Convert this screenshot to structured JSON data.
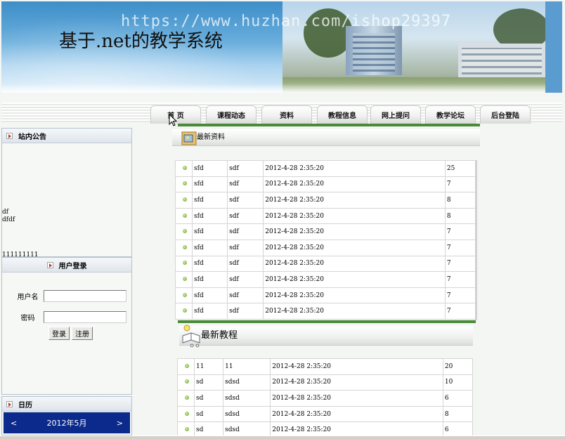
{
  "banner": {
    "watermark": "https://www.huzhan.com/ishop29397",
    "title": "基于.net的教学系统"
  },
  "nav": {
    "tabs": [
      "首 页",
      "课程动态",
      "资料",
      "教程信息",
      "网上提问",
      "教学论坛",
      "后台登陆"
    ]
  },
  "notice": {
    "heading": "站内公告",
    "lines": [
      "df",
      "dfdf"
    ],
    "bottom": "111111111"
  },
  "login": {
    "heading": "用户登录",
    "username_label": "用户名",
    "password_label": "密码",
    "username_value": "",
    "password_value": "",
    "login_button": "登录",
    "register_button": "注册"
  },
  "calendar": {
    "heading": "日历",
    "prev": "<",
    "month": "2012年5月",
    "next": ">"
  },
  "latest_materials": {
    "heading": "最新资料",
    "rows": [
      [
        "sfd",
        "sdf",
        "2012-4-28 2:35:20",
        "25"
      ],
      [
        "sfd",
        "sdf",
        "2012-4-28 2:35:20",
        "7"
      ],
      [
        "sfd",
        "sdf",
        "2012-4-28 2:35:20",
        "8"
      ],
      [
        "sfd",
        "sdf",
        "2012-4-28 2:35:20",
        "8"
      ],
      [
        "sfd",
        "sdf",
        "2012-4-28 2:35:20",
        "7"
      ],
      [
        "sfd",
        "sdf",
        "2012-4-28 2:35:20",
        "7"
      ],
      [
        "sfd",
        "sdf",
        "2012-4-28 2:35:20",
        "7"
      ],
      [
        "sfd",
        "sdf",
        "2012-4-28 2:35:20",
        "7"
      ],
      [
        "sfd",
        "sdf",
        "2012-4-28 2:35:20",
        "7"
      ],
      [
        "sfd",
        "sdf",
        "2012-4-28 2:35:20",
        "7"
      ]
    ]
  },
  "latest_tutorials": {
    "heading": "最新教程",
    "rows": [
      [
        "11",
        "11",
        "2012-4-28 2:35:20",
        "20"
      ],
      [
        "sd",
        "sdsd",
        "2012-4-28 2:35:20",
        "10"
      ],
      [
        "sd",
        "sdsd",
        "2012-4-28 2:35:20",
        "6"
      ],
      [
        "sd",
        "sdsd",
        "2012-4-28 2:35:20",
        "8"
      ],
      [
        "sd",
        "sdsd",
        "2012-4-28 2:35:20",
        "6"
      ]
    ]
  }
}
